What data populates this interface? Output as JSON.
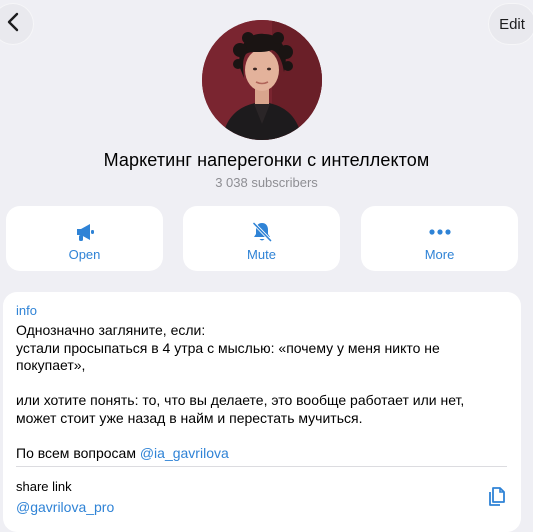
{
  "header": {
    "edit_label": "Edit"
  },
  "channel": {
    "title": "Маркетинг наперегонки с интеллектом",
    "subscribers": "3 038 subscribers"
  },
  "actions": [
    {
      "label": "Open",
      "icon": "megaphone-icon"
    },
    {
      "label": "Mute",
      "icon": "bell-slash-icon"
    },
    {
      "label": "More",
      "icon": "ellipsis-icon"
    }
  ],
  "info": {
    "label": "info",
    "text": "Однозначно загляните, если:\nустали просыпаться в 4 утра с мыслью: «почему у меня никто не покупает»,\n\nили хотите понять: то, что вы делаете, это вообще работает или нет, может стоит уже назад в найм и перестать мучиться.\n\n",
    "contact_prefix": "По всем вопросам ",
    "contact_handle": "@ia_gavrilova"
  },
  "share": {
    "label": "share link",
    "link": "@gavrilova_pro"
  },
  "colors": {
    "accent": "#2f83d6",
    "background": "#efeff4",
    "card": "#ffffff",
    "secondary_text": "#8e8e93"
  }
}
